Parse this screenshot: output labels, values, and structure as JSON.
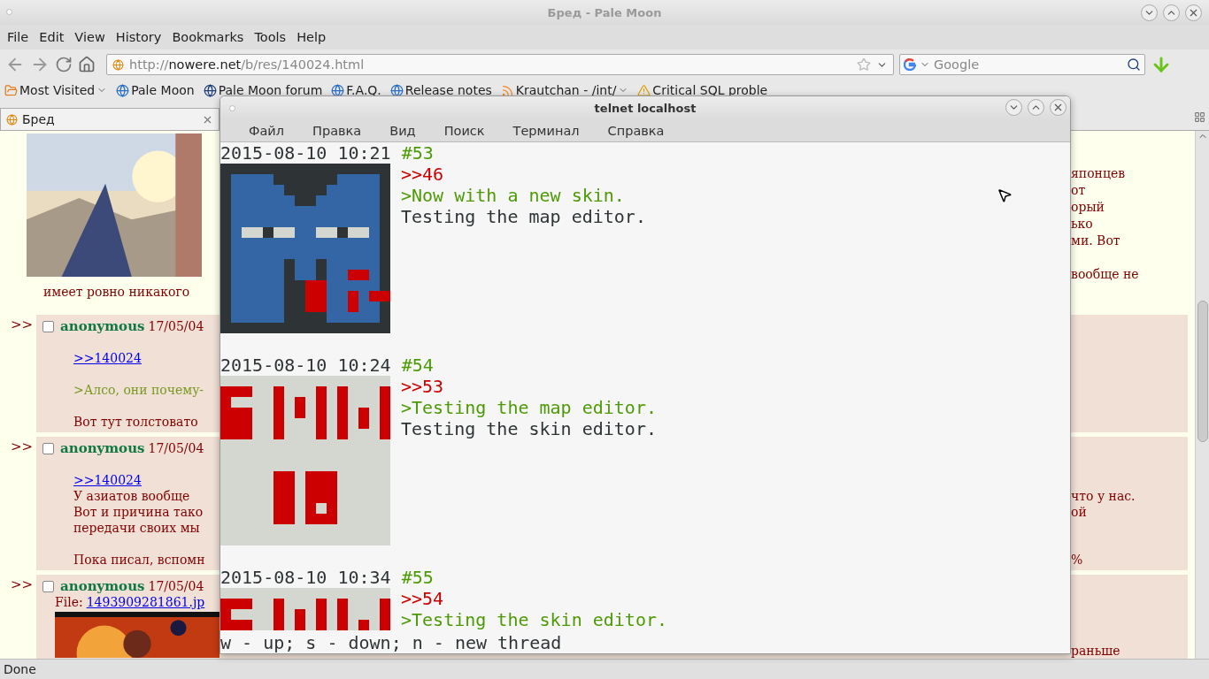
{
  "browser": {
    "title": "Бред - Pale Moon",
    "menu": [
      "File",
      "Edit",
      "View",
      "History",
      "Bookmarks",
      "Tools",
      "Help"
    ],
    "url": {
      "scheme": "http://",
      "host": "nowere.net",
      "path": "/b/res/140024.html"
    },
    "search": {
      "placeholder": "Google"
    },
    "bookmarks": [
      {
        "label": "Most Visited",
        "kind": "folder",
        "menu": true
      },
      {
        "label": "Pale Moon",
        "kind": "globe",
        "menu": false
      },
      {
        "label": "Pale Moon forum",
        "kind": "forum",
        "menu": false
      },
      {
        "label": "F.A.Q.",
        "kind": "globe",
        "menu": false
      },
      {
        "label": "Release notes",
        "kind": "globe",
        "menu": false
      },
      {
        "label": "Krautchan - /int/",
        "kind": "feed",
        "menu": true
      },
      {
        "label": "Critical SQL proble",
        "kind": "warning",
        "menu": false
      }
    ],
    "tabs": [
      {
        "label": "Бред",
        "selected": true
      }
    ],
    "status": "Done"
  },
  "thread": {
    "op": {
      "text": "имеет ровно никакого",
      "right_paragraphs": [
        [
          "японцев",
          "от",
          "орый",
          "ько",
          "ми. Вот"
        ],
        [
          "вообще не"
        ]
      ]
    },
    "posts": [
      {
        "marker": ">>",
        "checked": false,
        "name": "anonymous",
        "date": "17/05/04",
        "rows": [
          {
            "kind": "blank"
          },
          {
            "kind": "link",
            "left": ">>140024"
          },
          {
            "kind": "blank"
          },
          {
            "kind": "quote",
            "left": ">Алсо, они почему-"
          },
          {
            "kind": "blank"
          },
          {
            "kind": "text",
            "left": "Вот тут толстовато"
          }
        ]
      },
      {
        "marker": ">>",
        "checked": false,
        "name": "anonymous",
        "date": "17/05/04",
        "rows": [
          {
            "kind": "blank"
          },
          {
            "kind": "link",
            "left": ">>140024"
          },
          {
            "kind": "text",
            "left": "У азиатов вообще",
            "right": "что у нас."
          },
          {
            "kind": "text",
            "left": "Вот и причина тако",
            "right": "ой"
          },
          {
            "kind": "text",
            "left": "передачи своих мы"
          },
          {
            "kind": "blank"
          },
          {
            "kind": "text",
            "left": "Пока писал, вспомн",
            "right": "%"
          }
        ]
      },
      {
        "marker": ">>",
        "checked": false,
        "name": "anonymous",
        "date": "17/05/04",
        "rows": [
          {
            "kind": "file",
            "label": "File:",
            "left": "1493909281861.jp"
          },
          {
            "kind": "picture",
            "right": "раньше"
          }
        ]
      }
    ]
  },
  "terminal": {
    "title": "telnet localhost",
    "menu": [
      "Файл",
      "Правка",
      "Вид",
      "Поиск",
      "Терминал",
      "Справка"
    ],
    "posts": [
      {
        "time": "2015-08-10 10:21",
        "number": "#53",
        "lines": [
          {
            "kind": "reply",
            "text": ">>46"
          },
          {
            "kind": "quote",
            "text": ">Now with a new skin."
          },
          {
            "kind": "text",
            "text": "Testing the map editor."
          }
        ]
      },
      {
        "time": "2015-08-10 10:24",
        "number": "#54",
        "lines": [
          {
            "kind": "reply",
            "text": ">>53"
          },
          {
            "kind": "quote",
            "text": ">Testing the map editor."
          },
          {
            "kind": "text",
            "text": "Testing the skin editor."
          }
        ]
      },
      {
        "time": "2015-08-10 10:34",
        "number": "#55",
        "lines": [
          {
            "kind": "reply",
            "text": ">>54"
          },
          {
            "kind": "quote",
            "text": ">Testing the skin editor."
          }
        ]
      }
    ],
    "status_line": "w - up; s - down; n - new thread"
  }
}
